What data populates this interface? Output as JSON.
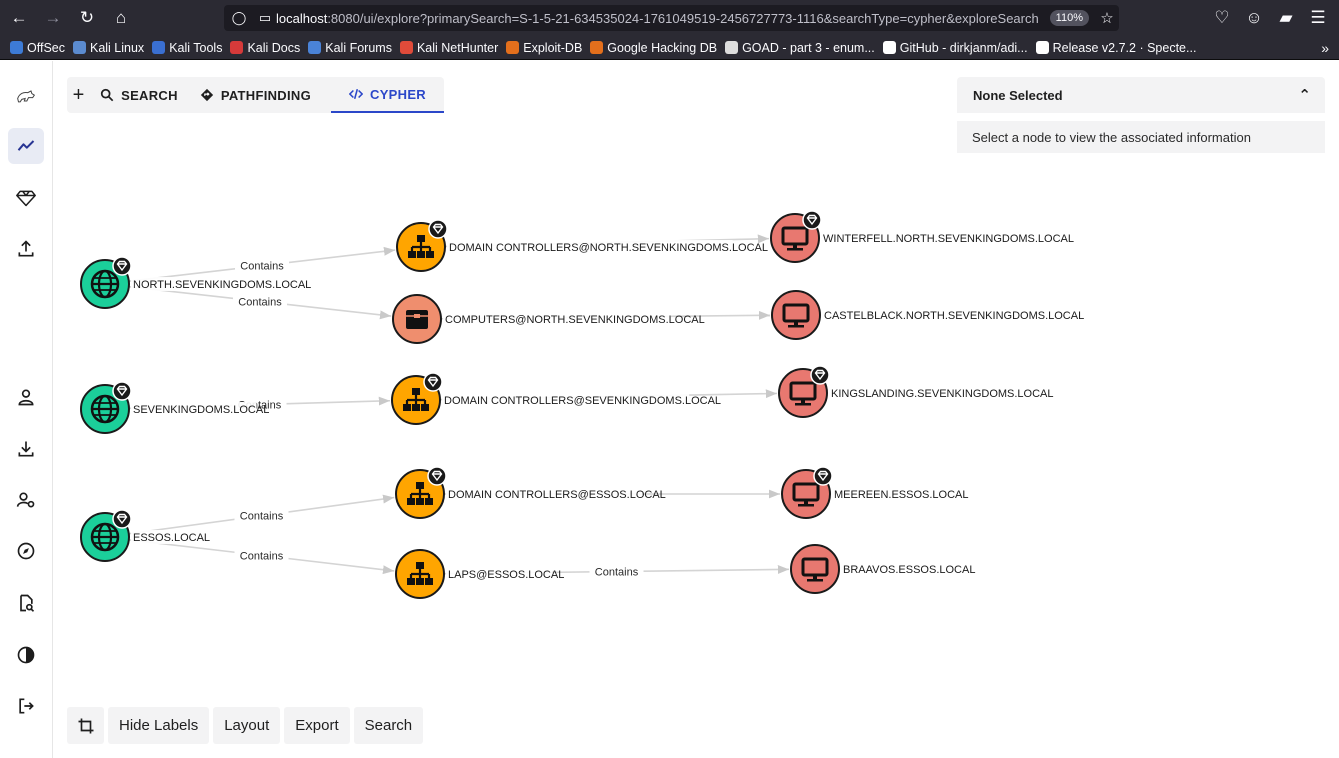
{
  "browser": {
    "url_host": "localhost",
    "url_rest": ":8080/ui/explore?primarySearch=S-1-5-21-634535024-1761049519-2456727773-1116&searchType=cypher&exploreSearch",
    "zoom": "110%",
    "bookmarks": [
      {
        "label": "OffSec",
        "color": "#3d7bd6"
      },
      {
        "label": "Kali Linux",
        "color": "#5b8bd0"
      },
      {
        "label": "Kali Tools",
        "color": "#3a6fd1"
      },
      {
        "label": "Kali Docs",
        "color": "#d63a3a"
      },
      {
        "label": "Kali Forums",
        "color": "#4a83d8"
      },
      {
        "label": "Kali NetHunter",
        "color": "#e04b3a"
      },
      {
        "label": "Exploit-DB",
        "color": "#e36f1c"
      },
      {
        "label": "Google Hacking DB",
        "color": "#e36f1c"
      },
      {
        "label": "GOAD - part 3 - enum...",
        "color": "#dddddd"
      },
      {
        "label": "GitHub - dirkjanm/adi...",
        "color": "#ffffff"
      },
      {
        "label": "Release v2.7.2 · Specte...",
        "color": "#ffffff"
      }
    ]
  },
  "tabs": {
    "plus": "+",
    "search": "SEARCH",
    "pathfinding": "PATHFINDING",
    "cypher": "CYPHER"
  },
  "info": {
    "title": "None Selected",
    "message": "Select a node to view the associated information"
  },
  "toolbar": {
    "hide_labels": "Hide Labels",
    "layout": "Layout",
    "export": "Export",
    "search": "Search"
  },
  "colors": {
    "domain": "#1bcf9a",
    "group": "#ffa500",
    "container": "#ef8e6e",
    "computer": "#e87870",
    "accent": "#2b47c9"
  },
  "graph": {
    "nodes": [
      {
        "id": "n1",
        "label": "NORTH.SEVENKINGDOMS.LOCAL",
        "kind": "domain",
        "tier0": true
      },
      {
        "id": "n2",
        "label": "DOMAIN CONTROLLERS@NORTH.SEVENKINGDOMS.LOCAL",
        "kind": "group",
        "tier0": true
      },
      {
        "id": "n3",
        "label": "WINTERFELL.NORTH.SEVENKINGDOMS.LOCAL",
        "kind": "computer",
        "tier0": true
      },
      {
        "id": "n4",
        "label": "COMPUTERS@NORTH.SEVENKINGDOMS.LOCAL",
        "kind": "container",
        "tier0": false
      },
      {
        "id": "n5",
        "label": "CASTELBLACK.NORTH.SEVENKINGDOMS.LOCAL",
        "kind": "computer",
        "tier0": false
      },
      {
        "id": "n6",
        "label": "SEVENKINGDOMS.LOCAL",
        "kind": "domain",
        "tier0": true
      },
      {
        "id": "n7",
        "label": "DOMAIN CONTROLLERS@SEVENKINGDOMS.LOCAL",
        "kind": "group",
        "tier0": true
      },
      {
        "id": "n8",
        "label": "KINGSLANDING.SEVENKINGDOMS.LOCAL",
        "kind": "computer",
        "tier0": true
      },
      {
        "id": "n9",
        "label": "ESSOS.LOCAL",
        "kind": "domain",
        "tier0": true
      },
      {
        "id": "n10",
        "label": "DOMAIN CONTROLLERS@ESSOS.LOCAL",
        "kind": "group",
        "tier0": true
      },
      {
        "id": "n11",
        "label": "MEEREEN.ESSOS.LOCAL",
        "kind": "computer",
        "tier0": true
      },
      {
        "id": "n12",
        "label": "LAPS@ESSOS.LOCAL",
        "kind": "group",
        "tier0": false
      },
      {
        "id": "n13",
        "label": "BRAAVOS.ESSOS.LOCAL",
        "kind": "computer",
        "tier0": false
      }
    ],
    "edges": [
      {
        "from": "n1",
        "to": "n2",
        "label": "Contains"
      },
      {
        "from": "n1",
        "to": "n4",
        "label": "Contains"
      },
      {
        "from": "n2",
        "to": "n3",
        "label": ""
      },
      {
        "from": "n4",
        "to": "n5",
        "label": ""
      },
      {
        "from": "n6",
        "to": "n7",
        "label": "Contains"
      },
      {
        "from": "n7",
        "to": "n8",
        "label": ""
      },
      {
        "from": "n9",
        "to": "n10",
        "label": "Contains"
      },
      {
        "from": "n9",
        "to": "n12",
        "label": "Contains"
      },
      {
        "from": "n10",
        "to": "n11",
        "label": ""
      },
      {
        "from": "n12",
        "to": "n13",
        "label": "Contains"
      }
    ]
  }
}
